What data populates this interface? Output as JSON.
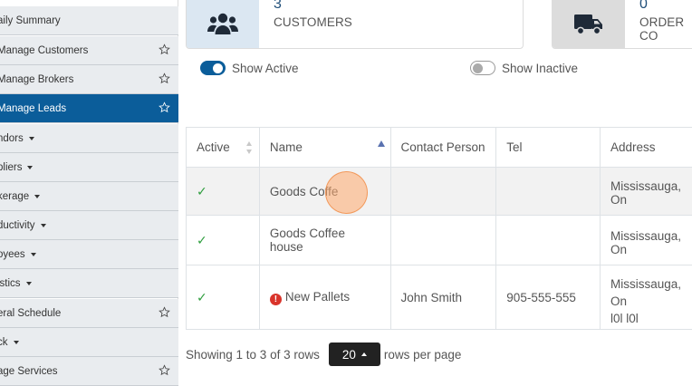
{
  "sidebar": {
    "items": [
      {
        "label": "aily Summary",
        "caret": false,
        "star": false,
        "active": false
      },
      {
        "label": "Manage Customers",
        "caret": false,
        "star": true,
        "active": false
      },
      {
        "label": "Manage Brokers",
        "caret": false,
        "star": true,
        "active": false
      },
      {
        "label": "Manage Leads",
        "caret": false,
        "star": true,
        "active": true
      },
      {
        "label": "ndors",
        "caret": true,
        "star": false,
        "active": false
      },
      {
        "label": "pliers",
        "caret": true,
        "star": false,
        "active": false
      },
      {
        "label": "kerage",
        "caret": true,
        "star": false,
        "active": false
      },
      {
        "label": "ductivity",
        "caret": true,
        "star": false,
        "active": false
      },
      {
        "label": "oyees",
        "caret": true,
        "star": false,
        "active": false
      },
      {
        "label": "istics",
        "caret": true,
        "star": false,
        "active": false
      },
      {
        "label": "eral Schedule",
        "caret": false,
        "star": true,
        "active": false
      },
      {
        "label": "ck",
        "caret": true,
        "star": false,
        "active": false
      },
      {
        "label": "age Services",
        "caret": false,
        "star": true,
        "active": false
      }
    ]
  },
  "cards": {
    "customers": {
      "count": "3",
      "caption": "CUSTOMERS",
      "icon": "users-icon"
    },
    "orders": {
      "count": "0",
      "caption": "ORDER CO",
      "icon": "truck-icon"
    }
  },
  "filters": {
    "show_active": "Show Active",
    "show_inactive": "Show Inactive"
  },
  "table": {
    "columns": [
      "Active",
      "Name",
      "Contact Person",
      "Tel",
      "Address"
    ],
    "rows": [
      {
        "active": "✓",
        "name": "Goods Coffe",
        "contact": "",
        "tel": "",
        "address": "Mississauga, On",
        "address2": "",
        "alert": false
      },
      {
        "active": "✓",
        "name": "Goods Coffee house",
        "contact": "",
        "tel": "",
        "address": "Mississauga, On",
        "address2": "",
        "alert": false
      },
      {
        "active": "✓",
        "name": "New Pallets",
        "contact": "John Smith",
        "tel": "905-555-555",
        "address": "Mississauga, On",
        "address2": "l0l l0l",
        "alert": true
      }
    ]
  },
  "pagination": {
    "summary": "Showing 1 to 3 of 3 rows",
    "page_size": "20",
    "suffix": "rows per page"
  },
  "colors": {
    "accent": "#0b5d9a",
    "check": "#2e9e3e",
    "alert": "#d9342b"
  }
}
